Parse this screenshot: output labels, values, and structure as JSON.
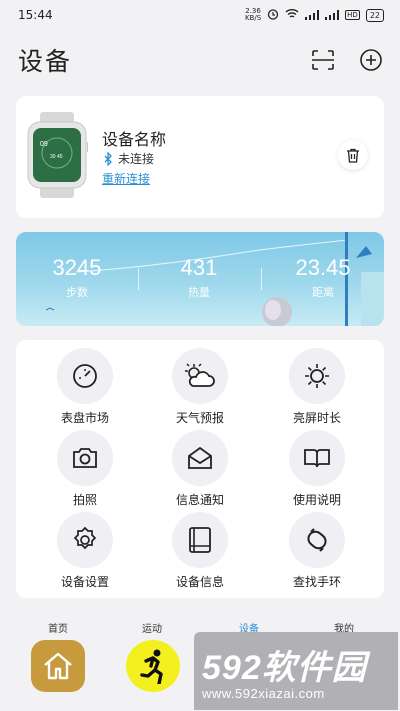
{
  "status_bar": {
    "time": "15:44",
    "net_speed": "2.36",
    "net_unit": "KB/S",
    "battery": "22"
  },
  "header": {
    "title": "设备",
    "scan_icon": "scan-icon",
    "add_icon": "plus-circle-icon"
  },
  "device": {
    "name": "设备名称",
    "status": "未连接",
    "reconnect": "重新连接",
    "watch_face_text": "09"
  },
  "stats": {
    "steps": {
      "value": "3245",
      "label": "步数"
    },
    "calories": {
      "value": "431",
      "label": "热量"
    },
    "distance": {
      "value": "23.45",
      "label": "距离"
    }
  },
  "features": [
    {
      "label": "表盘市场",
      "icon": "dial-icon"
    },
    {
      "label": "天气预报",
      "icon": "weather-icon"
    },
    {
      "label": "亮屏时长",
      "icon": "sun-icon"
    },
    {
      "label": "拍照",
      "icon": "camera-icon"
    },
    {
      "label": "信息通知",
      "icon": "envelope-icon"
    },
    {
      "label": "使用说明",
      "icon": "book-icon"
    },
    {
      "label": "设备设置",
      "icon": "gear-icon"
    },
    {
      "label": "设备信息",
      "icon": "device-info-icon"
    },
    {
      "label": "查找手环",
      "icon": "band-icon"
    }
  ],
  "tabs": [
    {
      "label": "首页"
    },
    {
      "label": "运动"
    },
    {
      "label": "设备"
    },
    {
      "label": "我的"
    }
  ],
  "watermark": {
    "brand": "592软件园",
    "url": "www.592xiazai.com"
  },
  "colors": {
    "accent": "#2a8fd4",
    "home_tab": "#c79a3e",
    "run_tab": "#f4ef1e"
  }
}
